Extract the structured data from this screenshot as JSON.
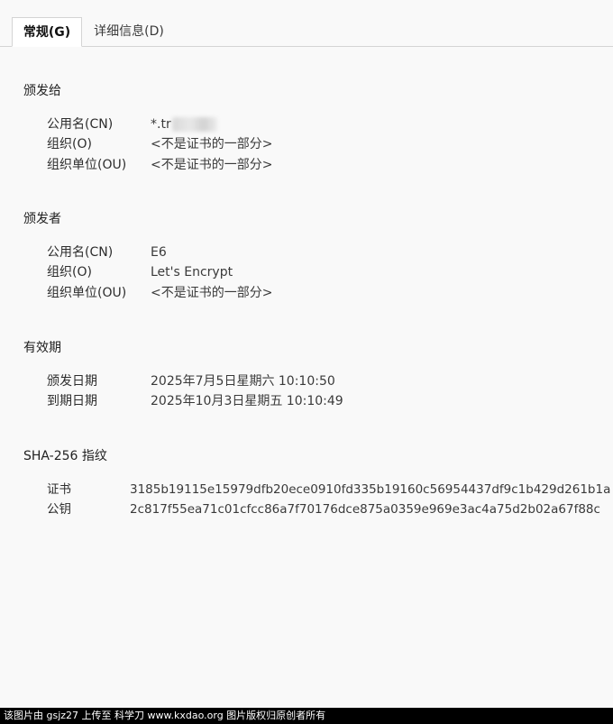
{
  "tabs": [
    {
      "label": "常规(G)",
      "active": true
    },
    {
      "label": "详细信息(D)",
      "active": false
    }
  ],
  "issued_to": {
    "title": "颁发给",
    "rows": [
      {
        "label": "公用名(CN)",
        "value": "*.tr"
      },
      {
        "label": "组织(O)",
        "value": "<不是证书的一部分>"
      },
      {
        "label": "组织单位(OU)",
        "value": "<不是证书的一部分>"
      }
    ]
  },
  "issued_by": {
    "title": "颁发者",
    "rows": [
      {
        "label": "公用名(CN)",
        "value": "E6"
      },
      {
        "label": "组织(O)",
        "value": "Let's Encrypt"
      },
      {
        "label": "组织单位(OU)",
        "value": "<不是证书的一部分>"
      }
    ]
  },
  "validity": {
    "title": "有效期",
    "rows": [
      {
        "label": "颁发日期",
        "value": "2025年7月5日星期六 10:10:50"
      },
      {
        "label": "到期日期",
        "value": "2025年10月3日星期五 10:10:49"
      }
    ]
  },
  "fingerprints": {
    "title": "SHA-256 指纹",
    "rows": [
      {
        "label": "证书",
        "value": "3185b19115e15979dfb20ece0910fd335b19160c56954437df9c1b429d261b1a"
      },
      {
        "label": "公钥",
        "value": "2c817f55ea71c01cfcc86a7f70176dce875a0359e969e3ac4a75d2b02a67f88c"
      }
    ]
  },
  "watermark": "该图片由 gsjz27 上传至 科学刀 www.kxdao.org 图片版权归原创者所有"
}
